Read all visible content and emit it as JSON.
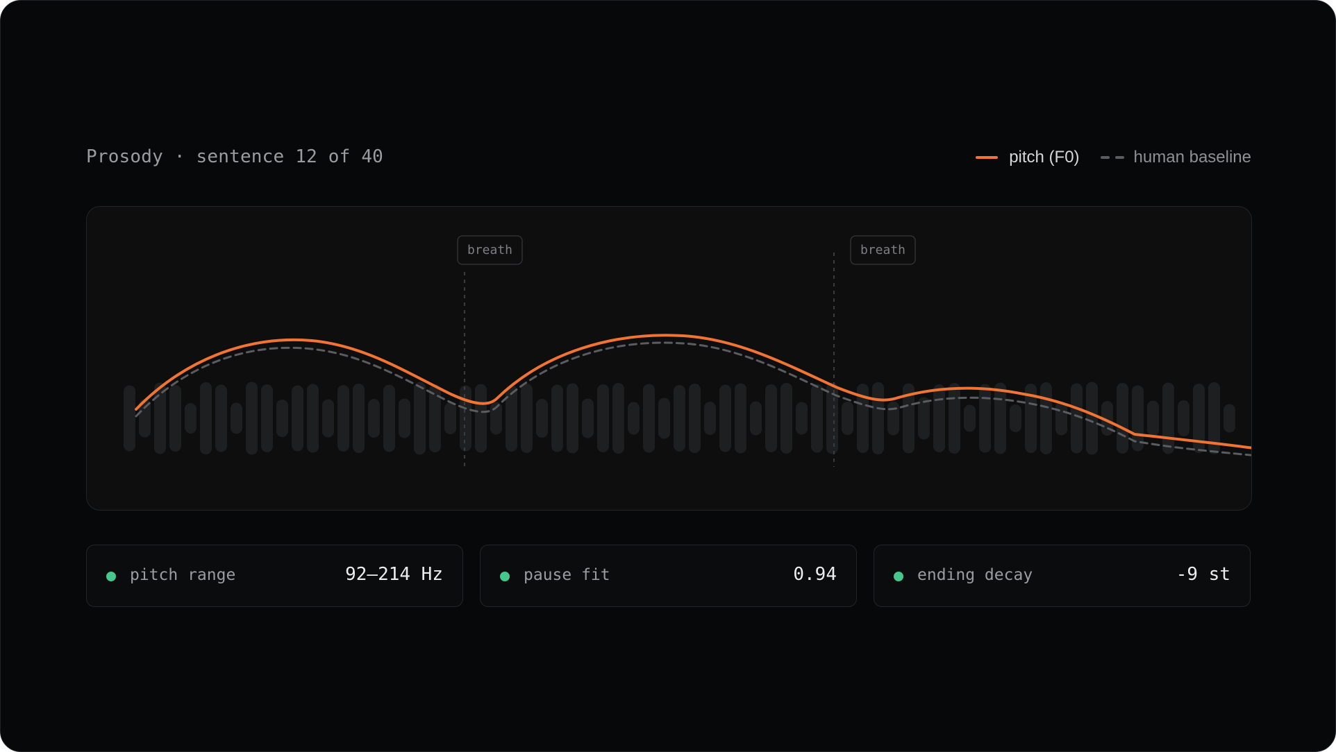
{
  "header": {
    "title": "Prosody · sentence 12 of 40"
  },
  "legend": {
    "pitch_label": "pitch (F0)",
    "baseline_label": "human baseline"
  },
  "colors": {
    "background": "#07080a",
    "pitch": "#f07434",
    "baseline": "#5a5c60",
    "waveform": "#1e1f21",
    "status_ok": "#46c88c"
  },
  "annotations": {
    "breath_1": "breath",
    "breath_2": "breath"
  },
  "stats": [
    {
      "label": "pitch range",
      "value": "92–214 Hz",
      "status": "ok"
    },
    {
      "label": "pause fit",
      "value": "0.94",
      "status": "ok"
    },
    {
      "label": "ending decay",
      "value": "-9 st",
      "status": "ok"
    }
  ]
}
